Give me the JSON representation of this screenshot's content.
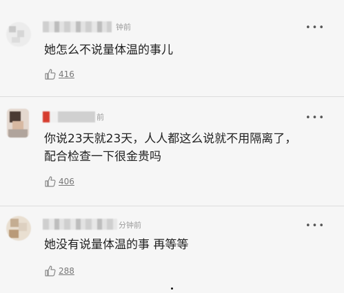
{
  "comments": [
    {
      "time": "钟前",
      "text": "她怎么不说量体温的事儿",
      "likes": "416",
      "more_icon": "more-icon"
    },
    {
      "time": "前",
      "text_lines": [
        "你说23天就23天，人人都这么说就不用隔离了，",
        "配合检查一下很金贵吗"
      ],
      "likes": "406",
      "more_icon": "more-icon"
    },
    {
      "time": "分钟前",
      "text": "她没有说量体温的事 再等等",
      "likes": "288",
      "more_icon": "more-icon"
    }
  ],
  "icons": {
    "like": "thumbs-up-icon",
    "more": "more-icon"
  },
  "colors": {
    "background": "#f6f6f6",
    "text": "#222222",
    "meta": "#9a9a9a",
    "divider": "#dcdcdc"
  }
}
